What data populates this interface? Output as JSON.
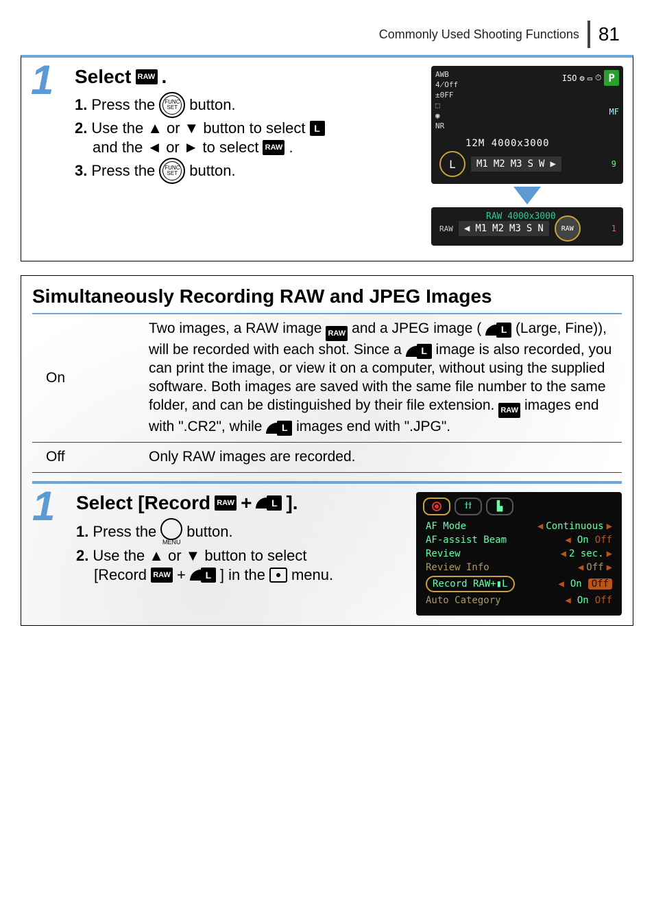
{
  "header": {
    "section_title": "Commonly Used Shooting Functions",
    "page_number": "81"
  },
  "step1": {
    "number": "1",
    "title_word": "Select",
    "title_icon_text": "RAW",
    "title_period": ".",
    "s1": {
      "num": "1.",
      "t1": "Press the",
      "func_top": "FUNC",
      "func_bot": "SET",
      "t2": "button."
    },
    "s2": {
      "num": "2.",
      "t1": "Use the",
      "up": "▲",
      "or": "or",
      "down": "▼",
      "t2": "button to select",
      "L": "L",
      "t3": "and the",
      "left": "◄",
      "or2": "or",
      "right": "►",
      "t4": "to select",
      "raw": "RAW",
      "t5": "."
    },
    "s3": {
      "num": "3.",
      "t1": "Press the",
      "func_top": "FUNC",
      "func_bot": "SET",
      "t2": "button."
    }
  },
  "lcd1": {
    "left": [
      "AWB",
      "4̸Off",
      "±0FF",
      "⬚",
      "◉",
      "NR"
    ],
    "right_icons": [
      "ISO",
      "⚙",
      "▭",
      "⏱"
    ],
    "p": "P",
    "mf": "MF",
    "info": "12M  4000x3000",
    "L": "L",
    "opts": [
      "M1",
      "M2",
      "M3",
      "S",
      "W"
    ],
    "tri_r": "▶",
    "shots": "9"
  },
  "lcd2": {
    "title": "RAW  4000x3000",
    "left_lbl": "RAW",
    "tri_l": "◀",
    "opts": [
      "M1",
      "M2",
      "M3",
      "S",
      "N"
    ],
    "raw_lbl": "RAW",
    "shots": "1"
  },
  "sect": {
    "title": "Simultaneously Recording RAW and JPEG Images",
    "on_label": "On",
    "on_desc_1": "Two images, a RAW image ",
    "on_desc_raw": "RAW",
    "on_desc_2": " and a JPEG image (",
    "on_desc_L": "L",
    "on_desc_3": " (Large, Fine)), will be recorded with each shot. Since a ",
    "on_desc_jp": "▮L",
    "on_desc_4": " image is also recorded, you can print the image, or view it on a computer, without using the supplied software. Both images are saved with the same file number to the same folder, and can be distinguished by their file extension. ",
    "on_desc_raw2": "RAW",
    "on_desc_5": " images end with \".CR2\", while ",
    "on_desc_jp2": "▮L",
    "on_desc_6": " images end with \".JPG\".",
    "off_label": "Off",
    "off_desc": "Only RAW images are recorded."
  },
  "step2": {
    "number": "1",
    "title_a": "Select [Record ",
    "title_raw": "RAW",
    "title_plus": "+",
    "title_L": "L",
    "title_b": "].",
    "s1": {
      "num": "1.",
      "t1": "Press the",
      "menu": "MENU",
      "t2": "button."
    },
    "s2": {
      "num": "2.",
      "t1": "Use the",
      "up": "▲",
      "or": "or",
      "down": "▼",
      "t2": "button to select",
      "t3": "[Record ",
      "raw": "RAW",
      "plus": "+",
      "L": "L",
      "t4": "] in the",
      "t5": "menu."
    }
  },
  "menu_lcd": {
    "rows": [
      {
        "k": "AF Mode",
        "v": "Continuous",
        "dim": false,
        "type": "tri"
      },
      {
        "k": "AF-assist Beam",
        "on": "On",
        "off": "Off",
        "dim": false,
        "type": "onoff",
        "sel": "on"
      },
      {
        "k": "Review",
        "v": "2 sec.",
        "dim": false,
        "type": "tri"
      },
      {
        "k": "Review Info",
        "v": "Off",
        "dim": true,
        "type": "tri"
      },
      {
        "k": "Record RAW+▮L",
        "on": "On",
        "off": "Off",
        "dim": false,
        "type": "onoff",
        "hl": true,
        "sel": "off"
      },
      {
        "k": "Auto Category",
        "on": "On",
        "off": "Off",
        "dim": true,
        "type": "onoff",
        "sel": "on"
      }
    ]
  }
}
